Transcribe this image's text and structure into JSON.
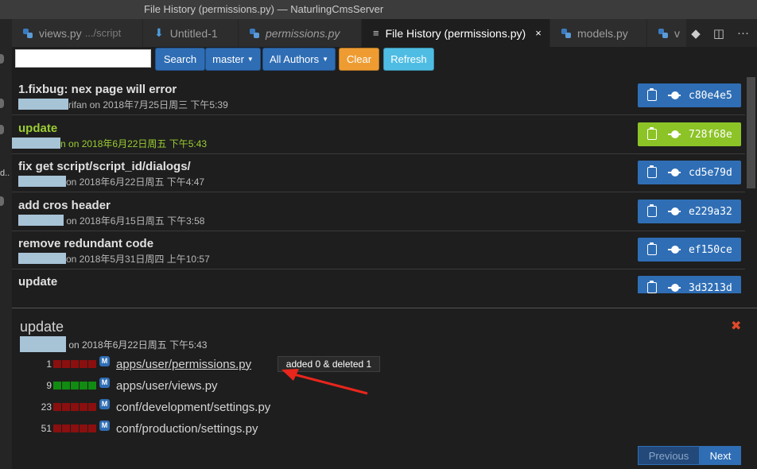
{
  "window": {
    "title": "File History (permissions.py) — NaturlingCmsServer"
  },
  "left_strip": {
    "label": "d.."
  },
  "tabs": [
    {
      "label": "views.py",
      "desc": ".../script",
      "type": "python"
    },
    {
      "label": "Untitled-1",
      "type": "untitled"
    },
    {
      "label": "permissions.py",
      "type": "python"
    },
    {
      "label": "File History (permissions.py)",
      "close": "×",
      "type": "history"
    },
    {
      "label": "models.py",
      "type": "python"
    },
    {
      "label": "v",
      "type": "python"
    }
  ],
  "tab_actions": {
    "git_icon": "◆",
    "split_icon": "◫",
    "more_icon": "···"
  },
  "toolbar": {
    "search_placeholder": "",
    "search_label": "Search",
    "branch_label": "master",
    "authors_label": "All Authors",
    "clear_label": "Clear",
    "refresh_label": "Refresh",
    "caret": "▼"
  },
  "commits": [
    {
      "message": "1.fixbug: nex page will error",
      "author_tail": "rifan",
      "date": " on 2018年7月25日周三 下午5:39",
      "sha": "c80e4e5"
    },
    {
      "message": "update",
      "author_tail": "n",
      "date": " on 2018年6月22日周五 下午5:43",
      "sha": "728f68e"
    },
    {
      "message": "fix get script/script_id/dialogs/",
      "author_tail": "",
      "date": "on 2018年6月22日周五 下午4:47",
      "sha": "cd5e79d"
    },
    {
      "message": "add cros header",
      "author_tail": "",
      "date": " on 2018年6月15日周五 下午3:58",
      "sha": "e229a32"
    },
    {
      "message": "remove redundant code",
      "author_tail": "",
      "date": "on 2018年5月31日周四 上午10:57",
      "sha": "ef150ce"
    },
    {
      "message": "update",
      "author_tail": "",
      "date": "",
      "sha": "3d3213d"
    }
  ],
  "detail": {
    "title": "update",
    "date": " on 2018年6月22日周五 下午5:43",
    "close": "✖",
    "files": [
      {
        "count": "1",
        "name": "apps/user/permissions.py",
        "badge": "M",
        "bars": "del"
      },
      {
        "count": "9",
        "name": "apps/user/views.py",
        "badge": "M",
        "bars": "add"
      },
      {
        "count": "23",
        "name": "conf/development/settings.py",
        "badge": "M",
        "bars": "del"
      },
      {
        "count": "51",
        "name": "conf/production/settings.py",
        "badge": "M",
        "bars": "del"
      }
    ],
    "tooltip": "added 0 & deleted 1"
  },
  "pager": {
    "previous_label": "Previous",
    "next_label": "Next"
  }
}
